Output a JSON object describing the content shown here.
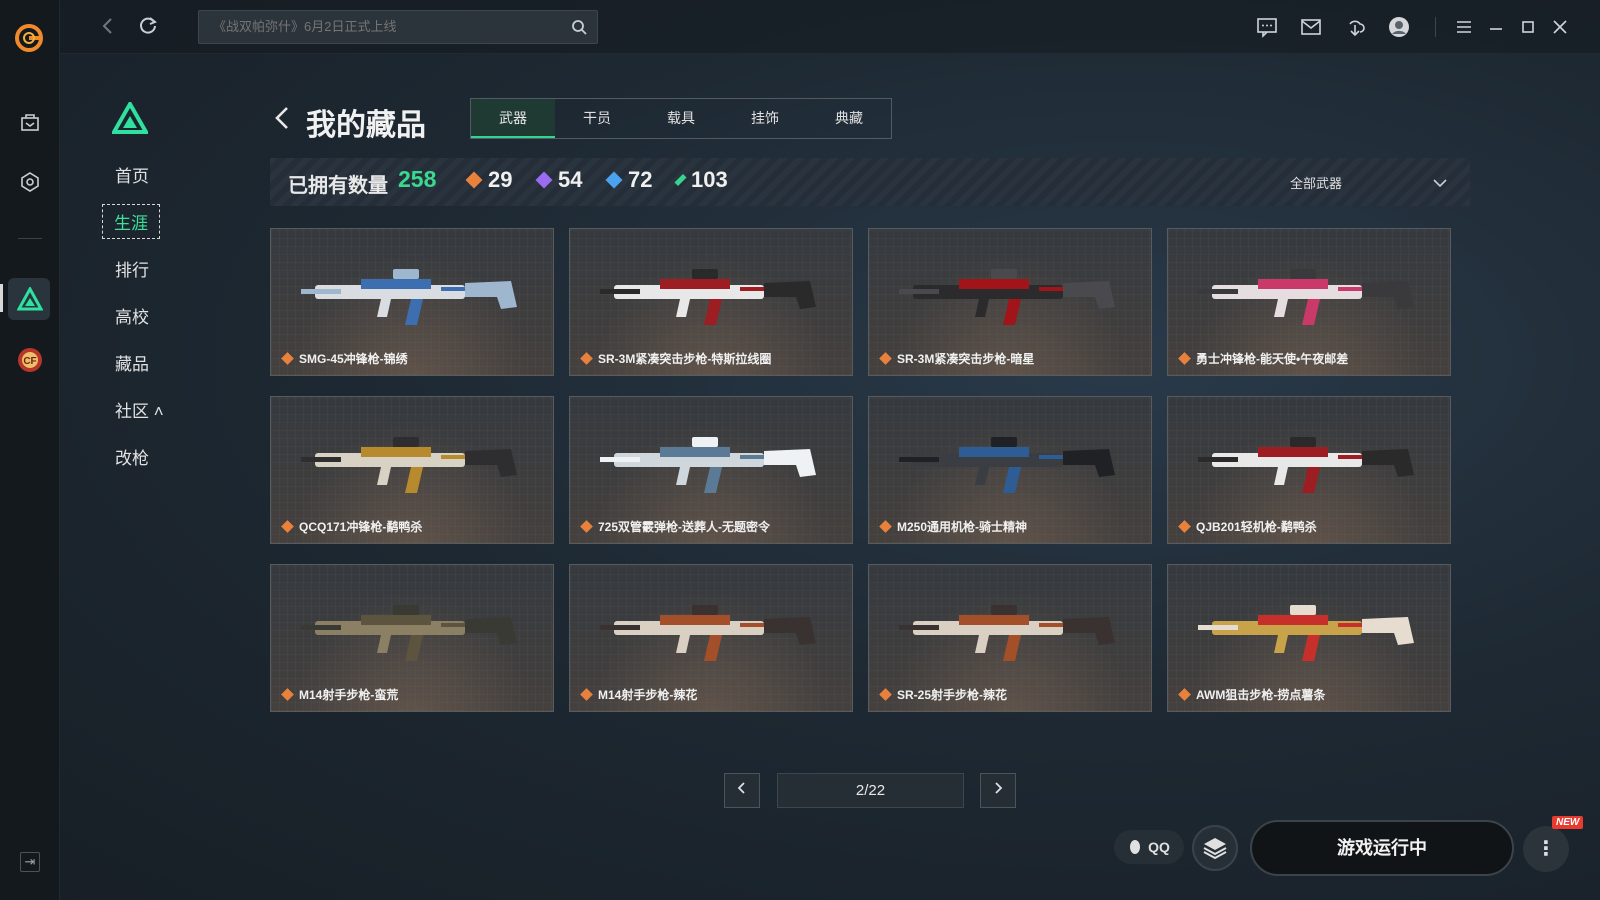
{
  "colors": {
    "accent_green": "#3ee09a",
    "bg": "#1e2933",
    "orange_rarity": "#e7813c",
    "purple_rarity": "#9b6cf0",
    "blue_rarity": "#4aa3f0",
    "green_rarity": "#36d58e"
  },
  "rail": {
    "icons": [
      "app-logo-icon",
      "bag-icon",
      "tag-icon",
      "game-triangle-icon",
      "cf-game-icon",
      "collapse-icon"
    ]
  },
  "topbar": {
    "search_placeholder": "《战双帕弥什》6月2日正式上线",
    "icons": [
      "chat-icon",
      "mail-icon",
      "download-icon",
      "user-avatar-icon",
      "menu-icon",
      "minimize-icon",
      "maximize-icon",
      "close-icon"
    ]
  },
  "subnav": {
    "items": [
      {
        "label": "首页"
      },
      {
        "label": "生涯"
      },
      {
        "label": "排行"
      },
      {
        "label": "高校"
      },
      {
        "label": "藏品"
      },
      {
        "label": "社区 ˄"
      },
      {
        "label": "改枪"
      }
    ]
  },
  "page": {
    "title": "我的藏品",
    "tabs": [
      {
        "label": "武器"
      },
      {
        "label": "干员"
      },
      {
        "label": "载具"
      },
      {
        "label": "挂饰"
      },
      {
        "label": "典藏"
      }
    ]
  },
  "stats": {
    "owned_label": "已拥有数量",
    "owned_total": "258",
    "counts": [
      {
        "value": "29",
        "rarity": "orange"
      },
      {
        "value": "54",
        "rarity": "purple"
      },
      {
        "value": "72",
        "rarity": "blue"
      },
      {
        "value": "103",
        "rarity": "green"
      }
    ],
    "filter_label": "全部武器"
  },
  "items": [
    {
      "name": "SMG-45冲锋枪-锦绣",
      "palette": "blue"
    },
    {
      "name": "SR-3M紧凑突击步枪-特斯拉线圈",
      "palette": "redwhite"
    },
    {
      "name": "SR-3M紧凑突击步枪-暗星",
      "palette": "darkred"
    },
    {
      "name": "勇士冲锋枪-能天使•午夜邮差",
      "palette": "pink"
    },
    {
      "name": "QCQ171冲锋枪-鹬鸭杀",
      "palette": "gold"
    },
    {
      "name": "725双管霰弹枪-送葬人-无题密令",
      "palette": "silver"
    },
    {
      "name": "M250通用机枪-骑士精神",
      "palette": "darkblue"
    },
    {
      "name": "QJB201轻机枪-鹬鸭杀",
      "palette": "redwhite"
    },
    {
      "name": "M14射手步枪-蛮荒",
      "palette": "olive"
    },
    {
      "name": "M14射手步枪-辣花",
      "palette": "copper"
    },
    {
      "name": "SR-25射手步枪-辣花",
      "palette": "copper"
    },
    {
      "name": "AWM狙击步枪-捞点薯条",
      "palette": "redgold"
    }
  ],
  "pager": {
    "current": "2/22"
  },
  "bottom": {
    "qq_label": "QQ",
    "run_label": "游戏运行中",
    "new_badge": "NEW"
  }
}
